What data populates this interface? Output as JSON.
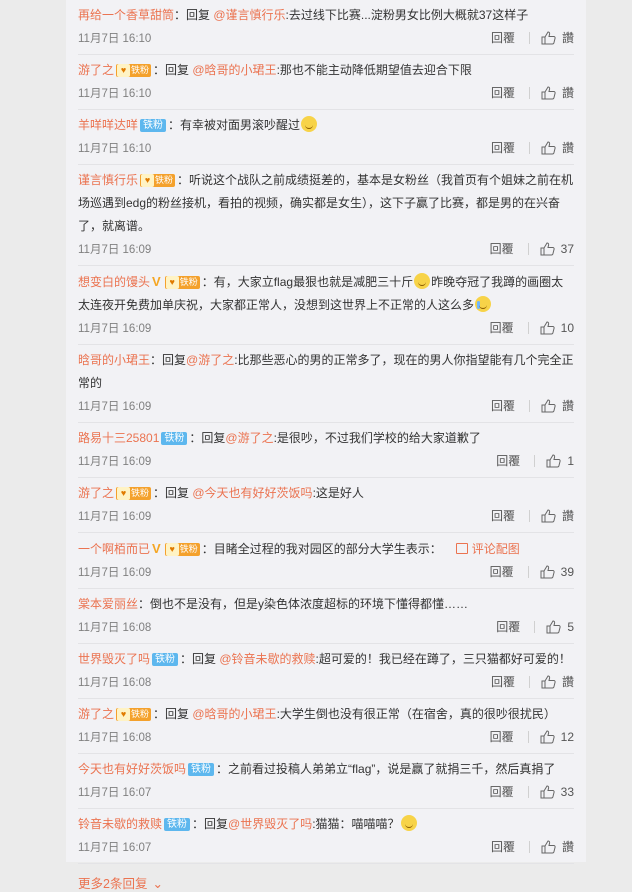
{
  "labels": {
    "reply": "回覆",
    "like_word": "讚"
  },
  "comments": [
    {
      "user": "再给一个香草甜筒",
      "badge": null,
      "reply_prefix": "：回复 ",
      "at": "@谨言慎行乐",
      "body": ":去过线下比赛...淀粉男女比例大概就37这样子",
      "time": "11月7日 16:10",
      "likes": "讚"
    },
    {
      "user": "游了之",
      "badge": "gold",
      "badge_text": "铁粉",
      "reply_prefix": "：回复 ",
      "at": "@晗哥的小珺王",
      "body": ":那也不能主动降低期望值去迎合下限",
      "time": "11月7日 16:10",
      "likes": "讚"
    },
    {
      "user": "羊咩咩达咩",
      "badge": "fan",
      "badge_text": "铁粉",
      "reply_prefix": "：",
      "at": "",
      "body": "有幸被对面男滚吵醒过",
      "emoji_after": "smile",
      "time": "11月7日 16:10",
      "likes": "讚"
    },
    {
      "user": "谨言慎行乐",
      "badge": "gold",
      "badge_text": "铁粉",
      "reply_prefix": "：",
      "at": "",
      "body": "听说这个战队之前成绩挺差的，基本是女粉丝（我首页有个姐妹之前在机场巡遇到edg的粉丝接机，看拍的视频，确实都是女生），这下子赢了比赛，都是男的在兴奋了，就离谱。",
      "time": "11月7日 16:09",
      "likes": "37"
    },
    {
      "user": "想变白的馒头",
      "badge": "gold",
      "badge_text": "铁粉",
      "vip": true,
      "reply_prefix": "：",
      "at": "",
      "body": "有，大家立flag最狠也就是减肥三十斤",
      "emoji_mid": "smile",
      "body2": "昨晚夺冠了我蹲的画圈太太连夜开免费加单庆祝，大家都正常人，没想到这世界上不正常的人这么多",
      "emoji_after": "cry",
      "time": "11月7日 16:09",
      "likes": "10"
    },
    {
      "user": "晗哥的小珺王",
      "badge": null,
      "reply_prefix": "：回复",
      "at": "@游了之",
      "body": ":比那些恶心的男的正常多了，现在的男人你指望能有几个完全正常的",
      "time": "11月7日 16:09",
      "likes": "讚"
    },
    {
      "user": "路易十三25801",
      "badge": "fan",
      "badge_text": "铁粉",
      "reply_prefix": "：回复",
      "at": "@游了之",
      "body": ":是很吵，不过我们学校的给大家道歉了",
      "time": "11月7日 16:09",
      "likes": "1"
    },
    {
      "user": "游了之",
      "badge": "gold",
      "badge_text": "铁粉",
      "reply_prefix": "：回复 ",
      "at": "@今天也有好好茨饭吗",
      "body": ":这是好人",
      "time": "11月7日 16:09",
      "likes": "讚"
    },
    {
      "user": "一个啊栢而已",
      "badge": "gold",
      "badge_text": "铁粉",
      "vip": true,
      "reply_prefix": "：",
      "at": "",
      "body": "目睹全过程的我对园区的部分大学生表示：",
      "pic_label": "评论配图",
      "time": "11月7日 16:09",
      "likes": "39"
    },
    {
      "user": "棠本爱丽丝",
      "badge": null,
      "reply_prefix": "：",
      "at": "",
      "body": "倒也不是没有，但是y染色体浓度超标的环境下懂得都懂……",
      "time": "11月7日 16:08",
      "likes": "5"
    },
    {
      "user": "世界毁灭了吗",
      "badge": "fan",
      "badge_text": "铁粉",
      "reply_prefix": "：回复 ",
      "at": "@铃音未歇的救赎",
      "body": ":超可爱的！我已经在蹲了，三只猫都好可爱的！",
      "time": "11月7日 16:08",
      "likes": "讚"
    },
    {
      "user": "游了之",
      "badge": "gold",
      "badge_text": "铁粉",
      "reply_prefix": "：回复 ",
      "at": "@晗哥的小珺王",
      "body": ":大学生倒也没有很正常（在宿舍，真的很吵很扰民）",
      "time": "11月7日 16:08",
      "likes": "12"
    },
    {
      "user": "今天也有好好茨饭吗",
      "badge": "fan",
      "badge_text": "铁粉",
      "reply_prefix": "：",
      "at": "",
      "body": "之前看过投稿人弟弟立“flag”，说是赢了就捐三千，然后真捐了",
      "time": "11月7日 16:07",
      "likes": "33"
    },
    {
      "user": "铃音未歇的救赎",
      "badge": "fan",
      "badge_text": "铁粉",
      "reply_prefix": "：回复",
      "at": "@世界毁灭了吗",
      "body": ":猫猫：喵喵喵？",
      "emoji_after": "laugh",
      "time": "11月7日 16:07",
      "likes": "讚"
    }
  ],
  "more_replies": "更多2条回复",
  "colors": {
    "username": "#eb7350",
    "fan_badge": "#5db7ee",
    "gold_badge": "#f4a12c"
  }
}
